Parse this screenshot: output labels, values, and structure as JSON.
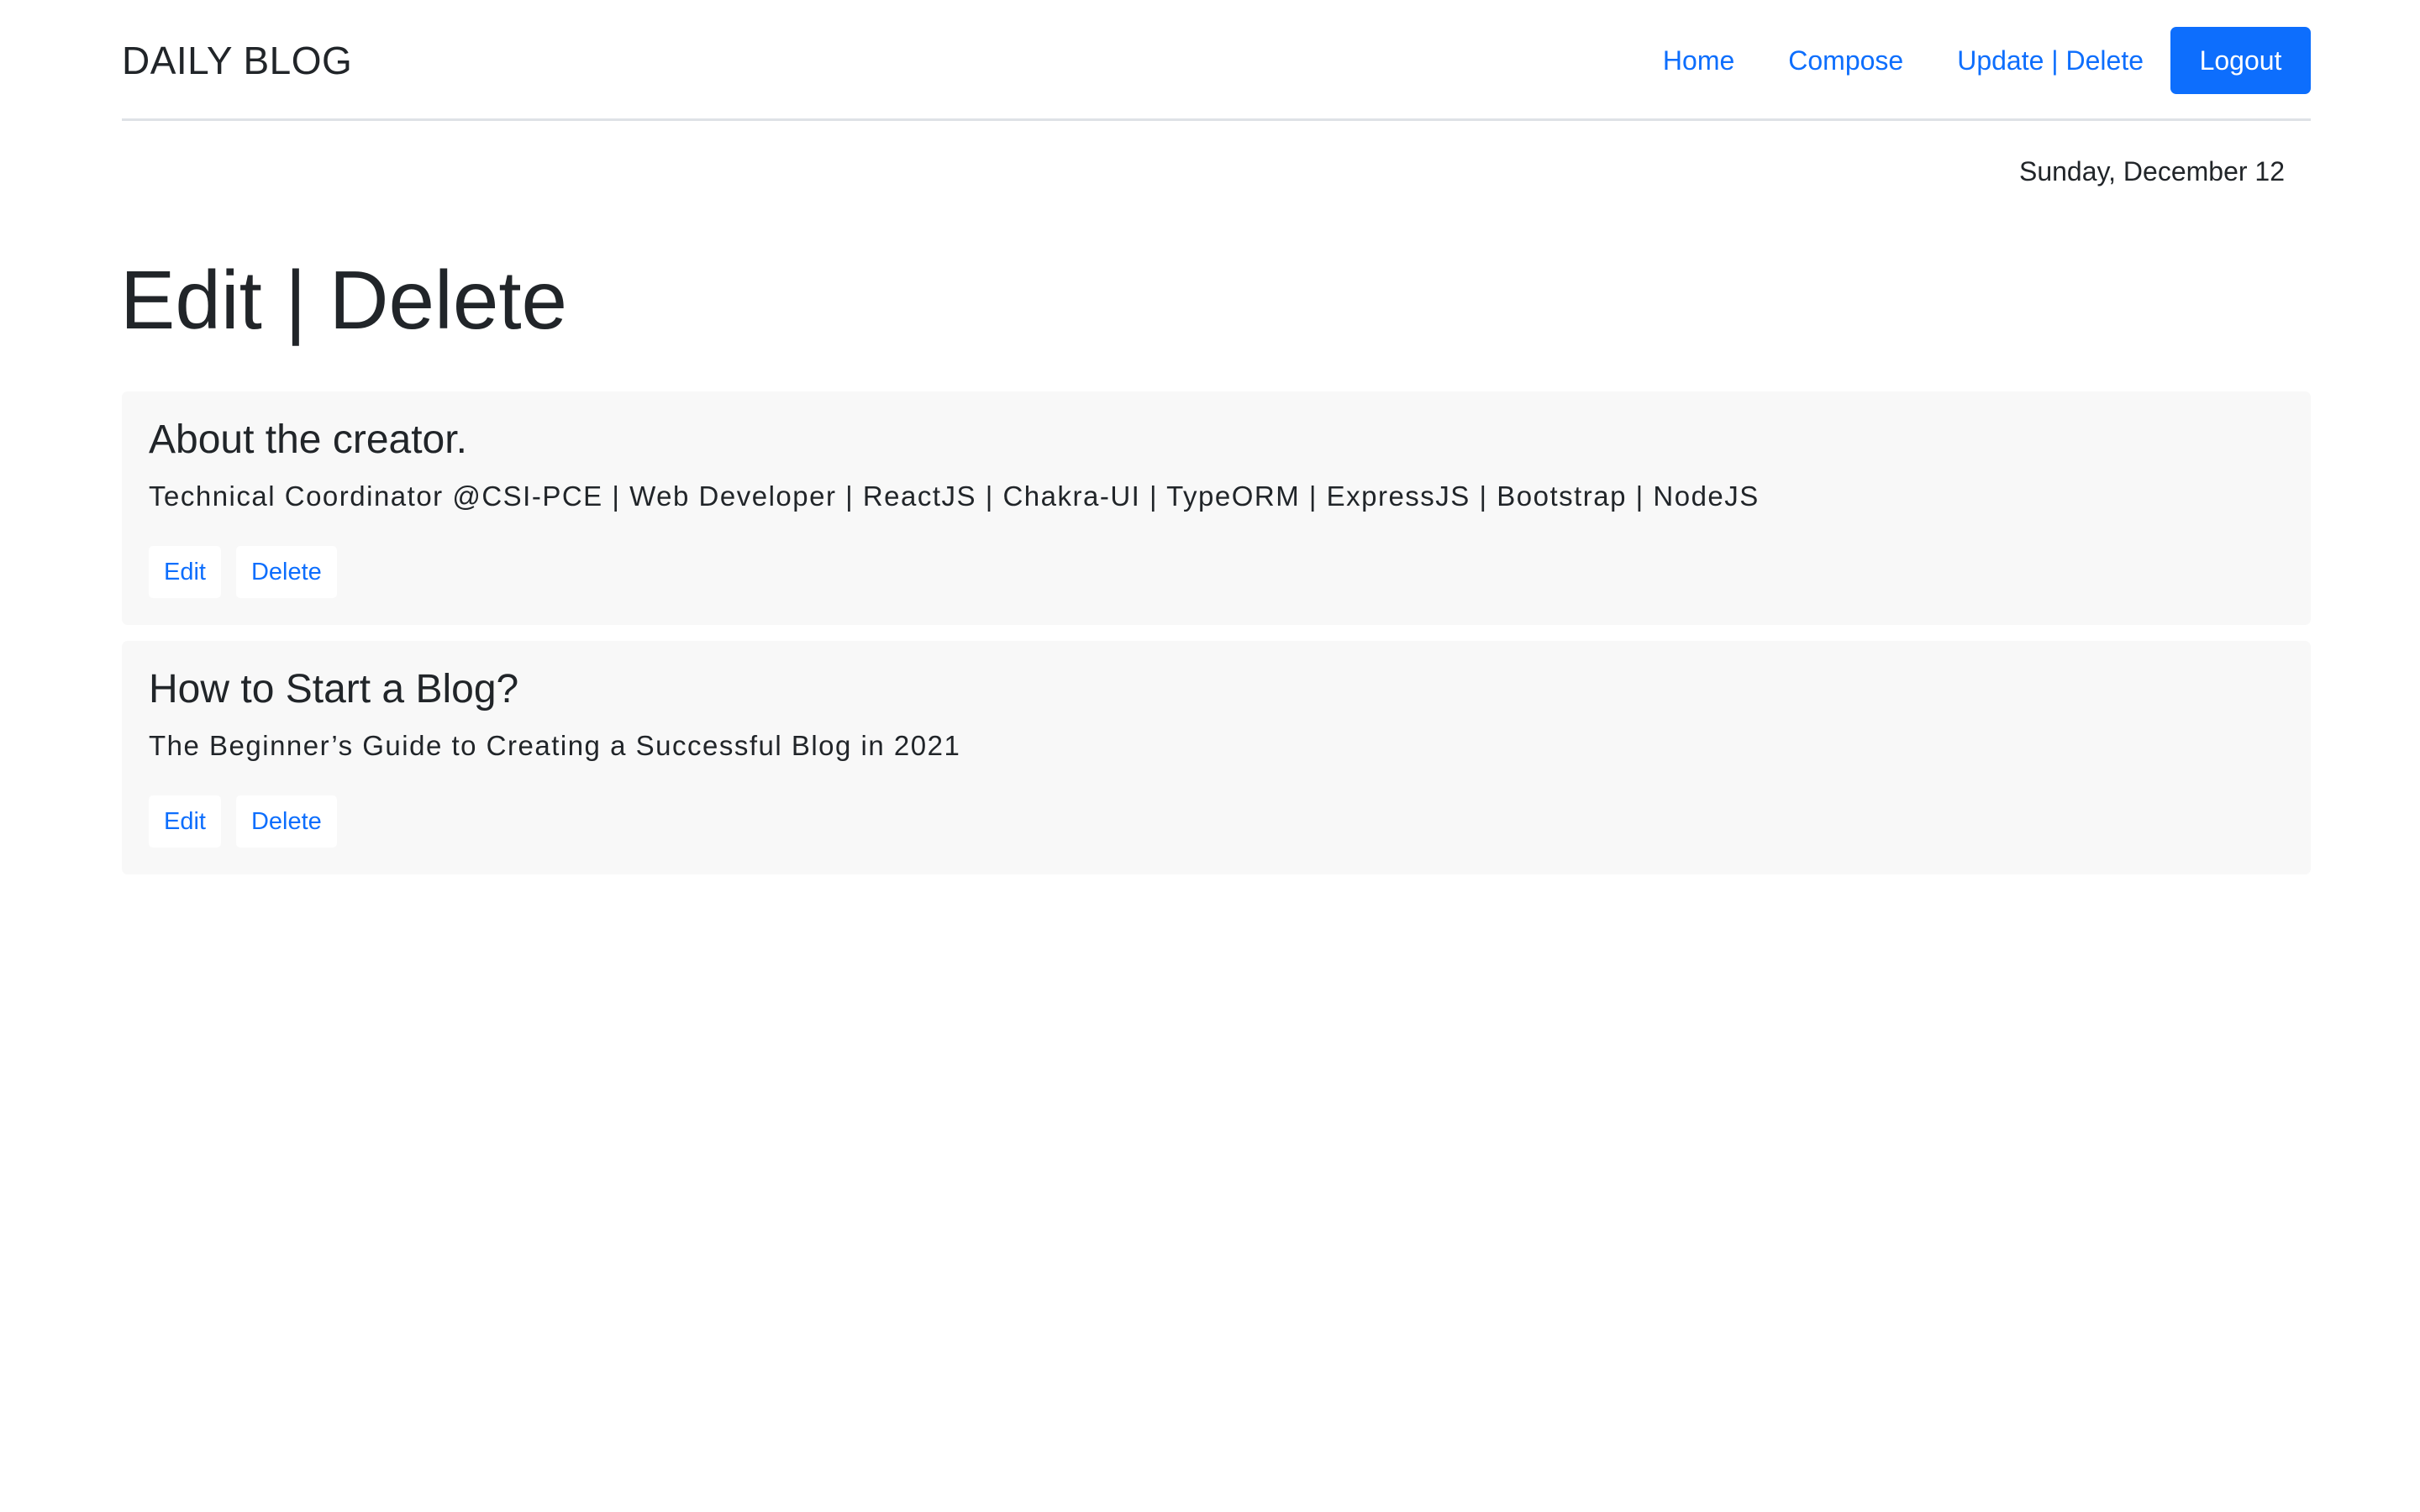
{
  "header": {
    "brand": "DAILY BLOG",
    "nav": [
      {
        "label": "Home"
      },
      {
        "label": "Compose"
      },
      {
        "label": "Update | Delete"
      }
    ],
    "logout_label": "Logout"
  },
  "date": "Sunday, December 12",
  "page_title": "Edit | Delete",
  "posts": [
    {
      "title": "About the creator.",
      "description": "Technical Coordinator @CSI-PCE | Web Developer | ReactJS | Chakra-UI | TypeORM | ExpressJS | Bootstrap | NodeJS",
      "edit_label": "Edit",
      "delete_label": "Delete"
    },
    {
      "title": "How to Start a Blog?",
      "description": "The Beginner’s Guide to Creating a Successful Blog in 2021",
      "edit_label": "Edit",
      "delete_label": "Delete"
    }
  ],
  "colors": {
    "accent": "#0d6efd",
    "card_background": "#f8f8f8",
    "text": "#212529",
    "divider": "#dee2e6"
  }
}
